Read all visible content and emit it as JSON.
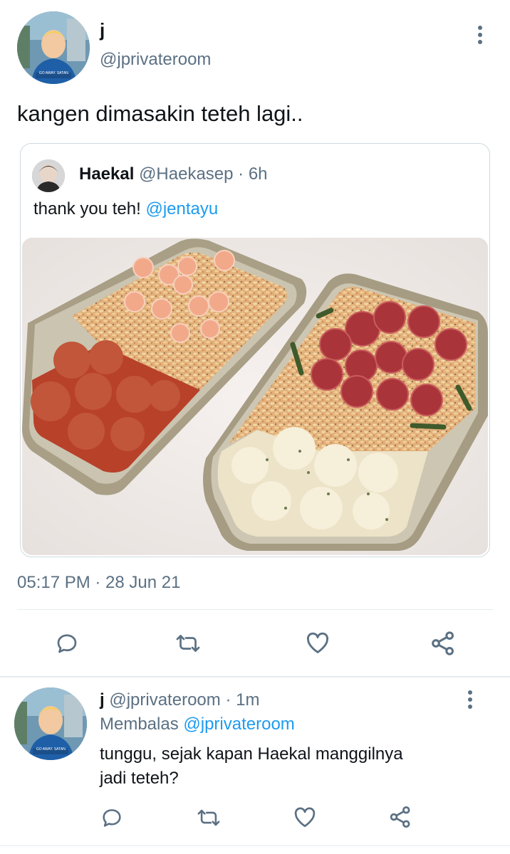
{
  "main_tweet": {
    "display_name": "j",
    "handle": "@jprivateroom",
    "avatar_caption": "GO AWAY. SATAN.",
    "text": "kangen dimasakin teteh lagi..",
    "timestamp": "05:17 PM · 28 Jun 21"
  },
  "quoted_tweet": {
    "display_name": "Haekal",
    "handle": "@Haekasep",
    "time": "· 6h",
    "text_prefix": "thank you teh! ",
    "mention": "@jentayu"
  },
  "actions": {
    "reply_icon": "reply-icon",
    "retweet_icon": "retweet-icon",
    "like_icon": "heart-icon",
    "share_icon": "share-icon"
  },
  "reply": {
    "display_name": "j",
    "handle": "@jprivateroom",
    "time": "· 1m",
    "replying_label": "Membalas",
    "replying_to": "@jprivateroom",
    "avatar_caption": "GO AWAY. SATAN.",
    "text_line1": "tunggu, sejak kapan Haekal manggilnya",
    "text_line2": "jadi teteh?"
  },
  "colors": {
    "accent": "#1d9bf0",
    "muted": "#5b7083",
    "text": "#0f1419",
    "divider": "#e6ecf0"
  }
}
